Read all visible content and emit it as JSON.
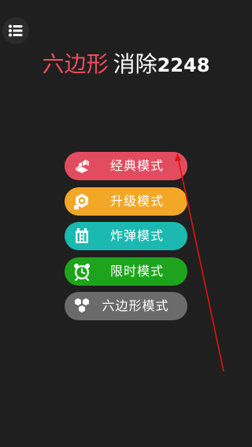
{
  "title": {
    "part1": "六边形",
    "part2": "消除",
    "part3": "2248"
  },
  "menu": {
    "icon": "list-menu-icon"
  },
  "modes": [
    {
      "label": "经典模式",
      "icon": "blocks-icon",
      "color": "#e24c5f"
    },
    {
      "label": "升级模式",
      "icon": "hexagon-level-icon",
      "color": "#f2a826"
    },
    {
      "label": "炸弹模式",
      "icon": "bomb-crate-icon",
      "color": "#1bb9b0"
    },
    {
      "label": "限时模式",
      "icon": "alarm-clock-icon",
      "color": "#1ea41c"
    },
    {
      "label": "六边形模式",
      "icon": "hexagon-cluster-icon",
      "color": "#6b6b6b"
    }
  ],
  "colors": {
    "background": "#1f1f1f",
    "accent": "#ef4a5d",
    "pointer_line": "#e01212"
  }
}
